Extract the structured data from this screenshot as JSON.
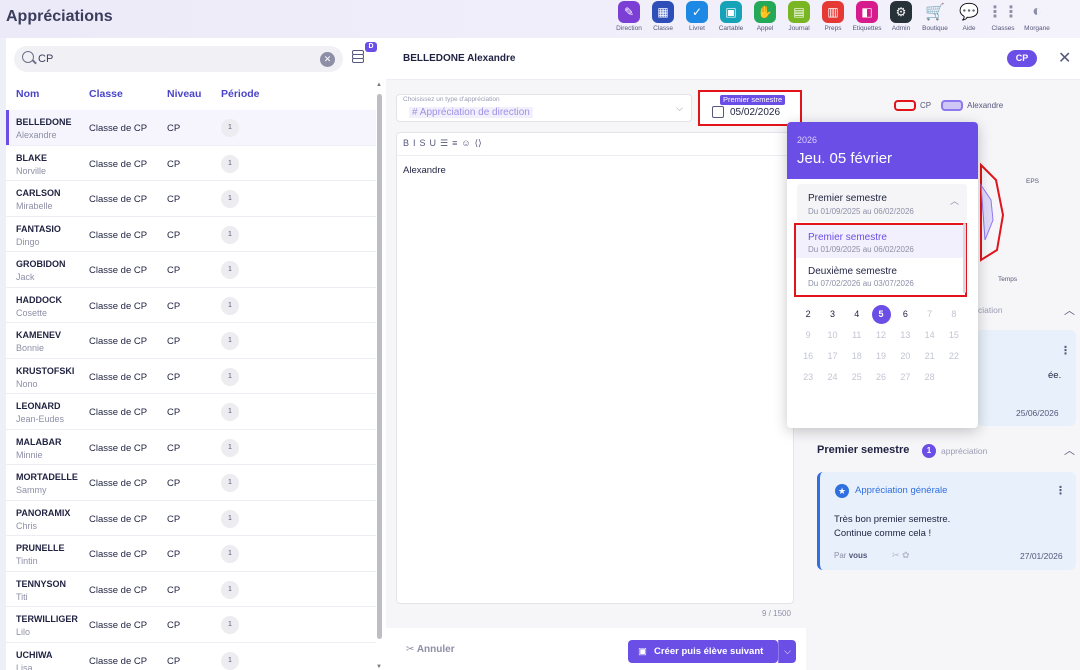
{
  "app": {
    "title": "Appréciations"
  },
  "nav": [
    {
      "label": "Direction",
      "icon": "pencil-icon",
      "color": "#7b3fd6",
      "glyph": "✎"
    },
    {
      "label": "Classe",
      "icon": "classroom-icon",
      "color": "#2f4fb8",
      "glyph": "▦"
    },
    {
      "label": "Livret",
      "icon": "checkbook-icon",
      "color": "#1e88e5",
      "glyph": "✓"
    },
    {
      "label": "Cartable",
      "icon": "bag-icon",
      "color": "#16a3b8",
      "glyph": "▣"
    },
    {
      "label": "Appel",
      "icon": "hand-icon",
      "color": "#23a957",
      "glyph": "✋"
    },
    {
      "label": "Journal",
      "icon": "calendar-icon",
      "color": "#7ab623",
      "glyph": "▤"
    },
    {
      "label": "Preps",
      "icon": "document-icon",
      "color": "#e53935",
      "glyph": "▥"
    },
    {
      "label": "Etiquettes",
      "icon": "tag-icon",
      "color": "#d81b8c",
      "glyph": "◧"
    },
    {
      "label": "Admin",
      "icon": "gear-icon",
      "color": "#263238",
      "glyph": "⚙"
    },
    {
      "label": "Boutique",
      "icon": "cart-icon",
      "color": "",
      "glyph": "🛒"
    },
    {
      "label": "Aide",
      "icon": "chat-icon",
      "color": "",
      "glyph": "💬"
    },
    {
      "label": "Classes",
      "icon": "grid-icon",
      "color": "",
      "glyph": "⋮⋮"
    },
    {
      "label": "Morgane",
      "icon": "avatar-icon",
      "color": "",
      "glyph": "◐"
    }
  ],
  "search": {
    "value": "CP",
    "badge": "D"
  },
  "list": {
    "headers": {
      "name": "Nom",
      "class": "Classe",
      "level": "Niveau",
      "period": "Période"
    },
    "rows": [
      {
        "last": "BELLEDONE",
        "first": "Alexandre",
        "class": "Classe de CP",
        "level": "CP",
        "period": "1"
      },
      {
        "last": "BLAKE",
        "first": "Norville",
        "class": "Classe de CP",
        "level": "CP",
        "period": "1"
      },
      {
        "last": "CARLSON",
        "first": "Mirabelle",
        "class": "Classe de CP",
        "level": "CP",
        "period": "1"
      },
      {
        "last": "FANTASIO",
        "first": "Dingo",
        "class": "Classe de CP",
        "level": "CP",
        "period": "1"
      },
      {
        "last": "GROBIDON",
        "first": "Jack",
        "class": "Classe de CP",
        "level": "CP",
        "period": "1"
      },
      {
        "last": "HADDOCK",
        "first": "Cosette",
        "class": "Classe de CP",
        "level": "CP",
        "period": "1"
      },
      {
        "last": "KAMENEV",
        "first": "Bonnie",
        "class": "Classe de CP",
        "level": "CP",
        "period": "1"
      },
      {
        "last": "KRUSTOFSKI",
        "first": "Nono",
        "class": "Classe de CP",
        "level": "CP",
        "period": "1"
      },
      {
        "last": "LEONARD",
        "first": "Jean-Eudes",
        "class": "Classe de CP",
        "level": "CP",
        "period": "1"
      },
      {
        "last": "MALABAR",
        "first": "Minnie",
        "class": "Classe de CP",
        "level": "CP",
        "period": "1"
      },
      {
        "last": "MORTADELLE",
        "first": "Sammy",
        "class": "Classe de CP",
        "level": "CP",
        "period": "1"
      },
      {
        "last": "PANORAMIX",
        "first": "Chris",
        "class": "Classe de CP",
        "level": "CP",
        "period": "1"
      },
      {
        "last": "PRUNELLE",
        "first": "Tintin",
        "class": "Classe de CP",
        "level": "CP",
        "period": "1"
      },
      {
        "last": "TENNYSON",
        "first": "Titi",
        "class": "Classe de CP",
        "level": "CP",
        "period": "1"
      },
      {
        "last": "TERWILLIGER",
        "first": "Lilo",
        "class": "Classe de CP",
        "level": "CP",
        "period": "1"
      },
      {
        "last": "UCHIWA",
        "first": "Lisa",
        "class": "Classe de CP",
        "level": "CP",
        "period": "1"
      }
    ]
  },
  "student": {
    "name": "BELLEDONE Alexandre",
    "level": "CP"
  },
  "editor": {
    "type_label": "Choisissez un type d'appréciation",
    "type_value": "# Appréciation de direction",
    "period_tag": "Premier semestre",
    "date": "05/02/2026",
    "toolbar": [
      "B",
      "I",
      "S",
      "U",
      "☰",
      "≡",
      "☺",
      "⟨⟩"
    ],
    "text": "Alexandre",
    "counter": "9 / 1500",
    "cancel_label": "Annuler",
    "primary_label": "Créer puis élève suivant"
  },
  "right": {
    "legend_cp": "CP",
    "legend_student": "Alexandre",
    "radar_eps": "EPS",
    "radar_temps": "Temps",
    "ghost_title": "ciation",
    "card1_text": "ée.",
    "card1_date": "25/06/2026",
    "section": {
      "title": "Premier semestre",
      "count": "1",
      "sub": "appréciation"
    },
    "card2": {
      "title": "Appréciation générale",
      "line1": "Très bon premier semestre.",
      "line2": "Continue comme cela !",
      "by_prefix": "Par",
      "by_name": "vous",
      "date": "27/01/2026"
    }
  },
  "picker": {
    "year": "2026",
    "date_label": "Jeu. 05 février",
    "selected": {
      "name": "Premier semestre",
      "range": "Du 01/09/2025 au 06/02/2026"
    },
    "options": [
      {
        "name": "Premier semestre",
        "range": "Du 01/09/2025 au 06/02/2026"
      },
      {
        "name": "Deuxième semestre",
        "range": "Du 07/02/2026 au 03/07/2026"
      }
    ],
    "weeks": [
      [
        {
          "d": "2",
          "en": true
        },
        {
          "d": "3",
          "en": true
        },
        {
          "d": "4",
          "en": true
        },
        {
          "d": "5",
          "en": true,
          "today": true
        },
        {
          "d": "6",
          "en": true
        },
        {
          "d": "7",
          "en": false
        },
        {
          "d": "8",
          "en": false
        }
      ],
      [
        {
          "d": "9",
          "en": false
        },
        {
          "d": "10",
          "en": false
        },
        {
          "d": "11",
          "en": false
        },
        {
          "d": "12",
          "en": false
        },
        {
          "d": "13",
          "en": false
        },
        {
          "d": "14",
          "en": false
        },
        {
          "d": "15",
          "en": false
        }
      ],
      [
        {
          "d": "16",
          "en": false
        },
        {
          "d": "17",
          "en": false
        },
        {
          "d": "18",
          "en": false
        },
        {
          "d": "19",
          "en": false
        },
        {
          "d": "20",
          "en": false
        },
        {
          "d": "21",
          "en": false
        },
        {
          "d": "22",
          "en": false
        }
      ],
      [
        {
          "d": "23",
          "en": false
        },
        {
          "d": "24",
          "en": false
        },
        {
          "d": "25",
          "en": false
        },
        {
          "d": "26",
          "en": false
        },
        {
          "d": "27",
          "en": false
        },
        {
          "d": "28",
          "en": false
        }
      ]
    ]
  }
}
